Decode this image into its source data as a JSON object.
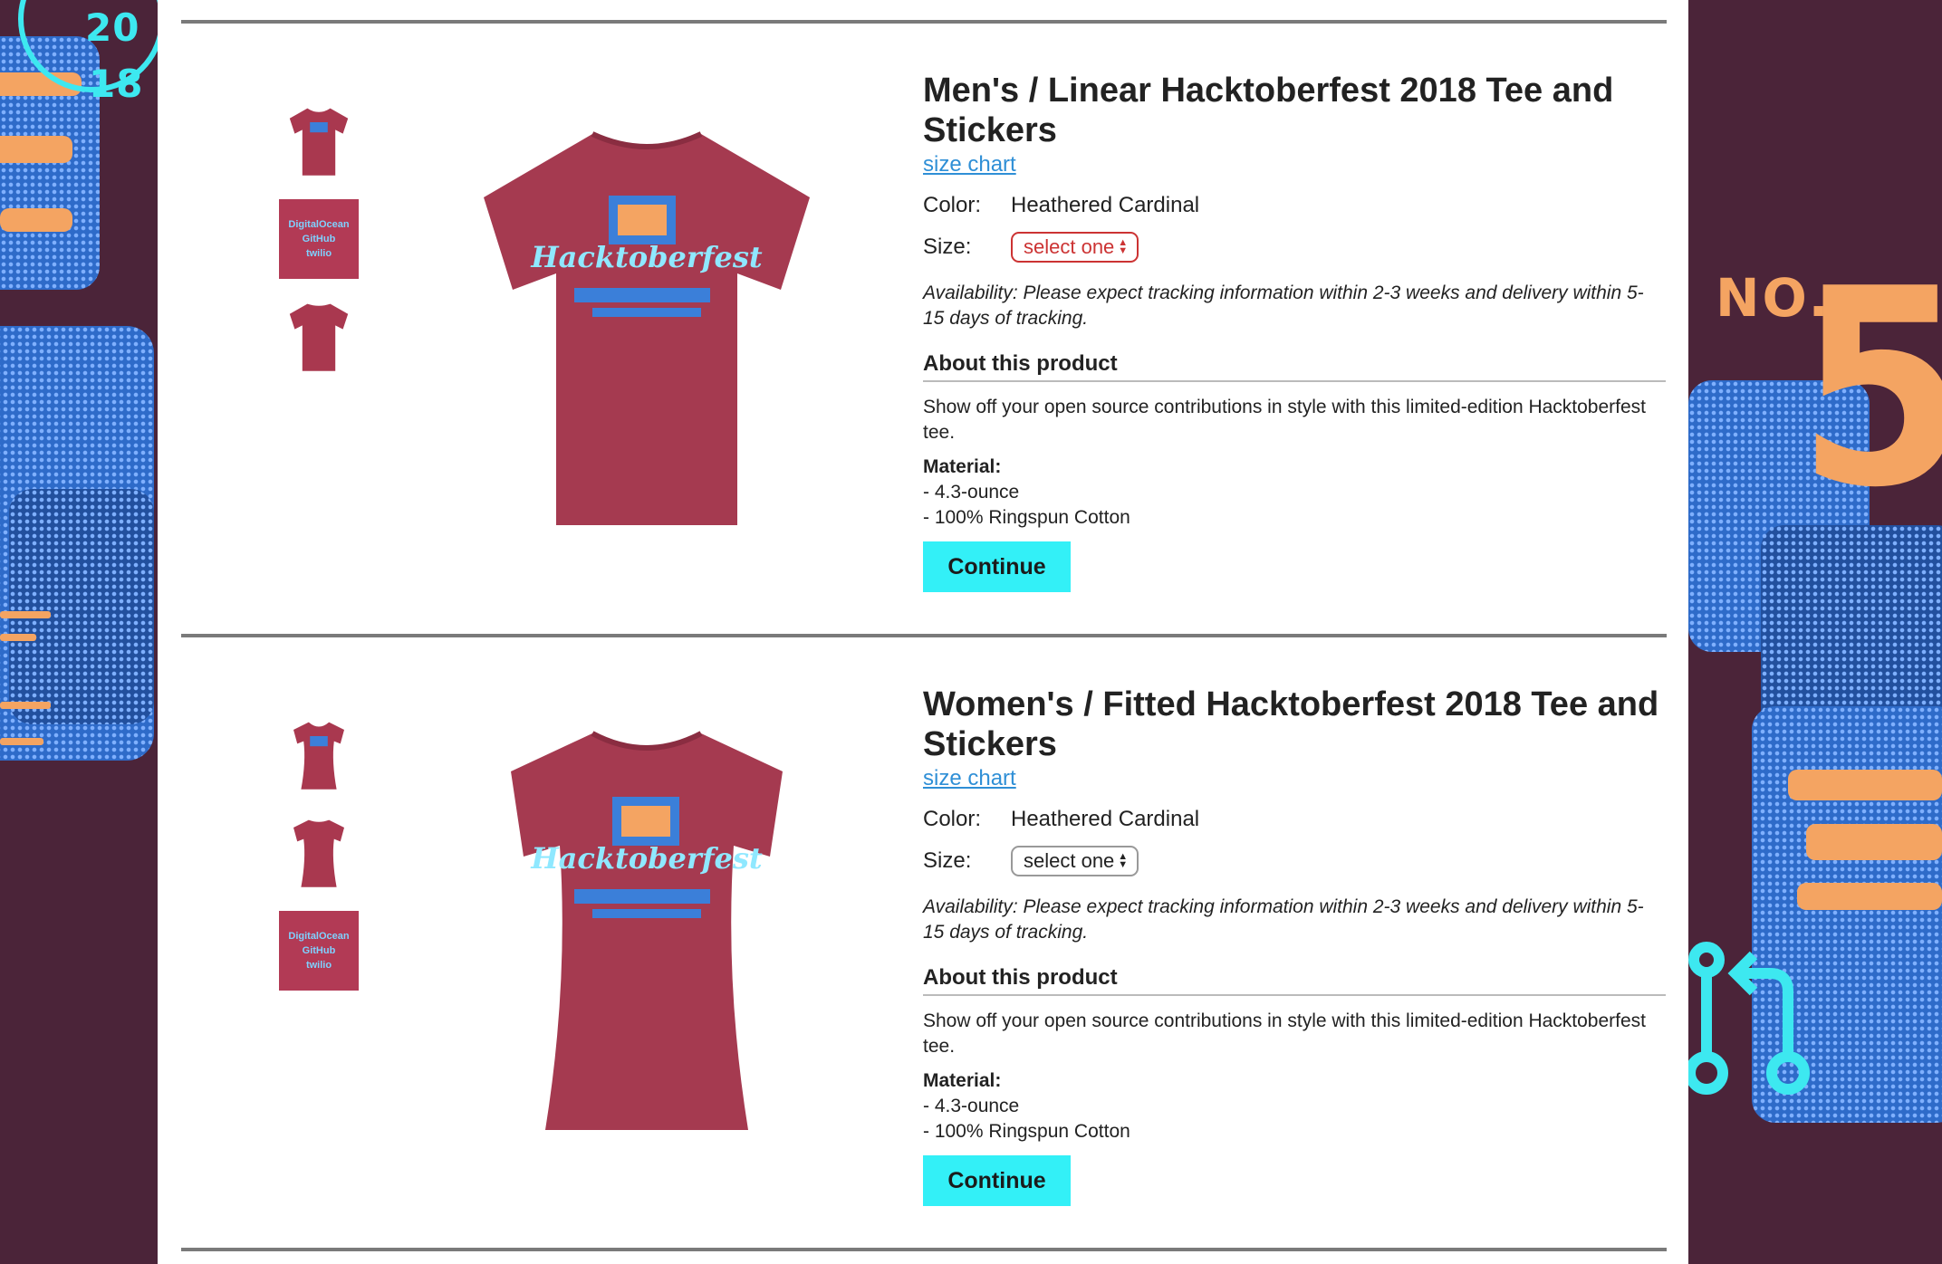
{
  "brand": {
    "year_top": "20",
    "year_bottom": "18",
    "number_label": "NO.",
    "number_value": "5",
    "colors": {
      "purple": "#4b2439",
      "blue": "#2e6bc9",
      "orange": "#f4a462",
      "cyan": "#3de8f0"
    }
  },
  "products": [
    {
      "title": "Men's / Linear Hacktoberfest 2018 Tee and Stickers",
      "size_chart": "size chart",
      "color_label": "Color:",
      "color_value": "Heathered Cardinal",
      "size_label": "Size:",
      "size_value": "select one",
      "size_state": "error",
      "availability": "Availability: Please expect tracking information within 2-3 weeks and delivery within 5-15 days of tracking.",
      "about_heading": "About this product",
      "description": "Show off your open source contributions in style with this limited-edition Hacktoberfest tee.",
      "material_heading": "Material:",
      "materials": [
        "- 4.3-ounce",
        "- 100% Ringspun Cotton"
      ],
      "button": "Continue",
      "shirt_print": "Hacktoberfest",
      "sticker_lines": [
        "DigitalOcean",
        "GitHub",
        "twilio"
      ]
    },
    {
      "title": "Women's / Fitted Hacktoberfest 2018 Tee and Stickers",
      "size_chart": "size chart",
      "color_label": "Color:",
      "color_value": "Heathered Cardinal",
      "size_label": "Size:",
      "size_value": "select one",
      "size_state": "normal",
      "availability": "Availability: Please expect tracking information within 2-3 weeks and delivery within 5-15 days of tracking.",
      "about_heading": "About this product",
      "description": "Show off your open source contributions in style with this limited-edition Hacktoberfest tee.",
      "material_heading": "Material:",
      "materials": [
        "- 4.3-ounce",
        "- 100% Ringspun Cotton"
      ],
      "button": "Continue",
      "shirt_print": "Hacktoberfest",
      "sticker_lines": [
        "DigitalOcean",
        "GitHub",
        "twilio"
      ]
    }
  ]
}
